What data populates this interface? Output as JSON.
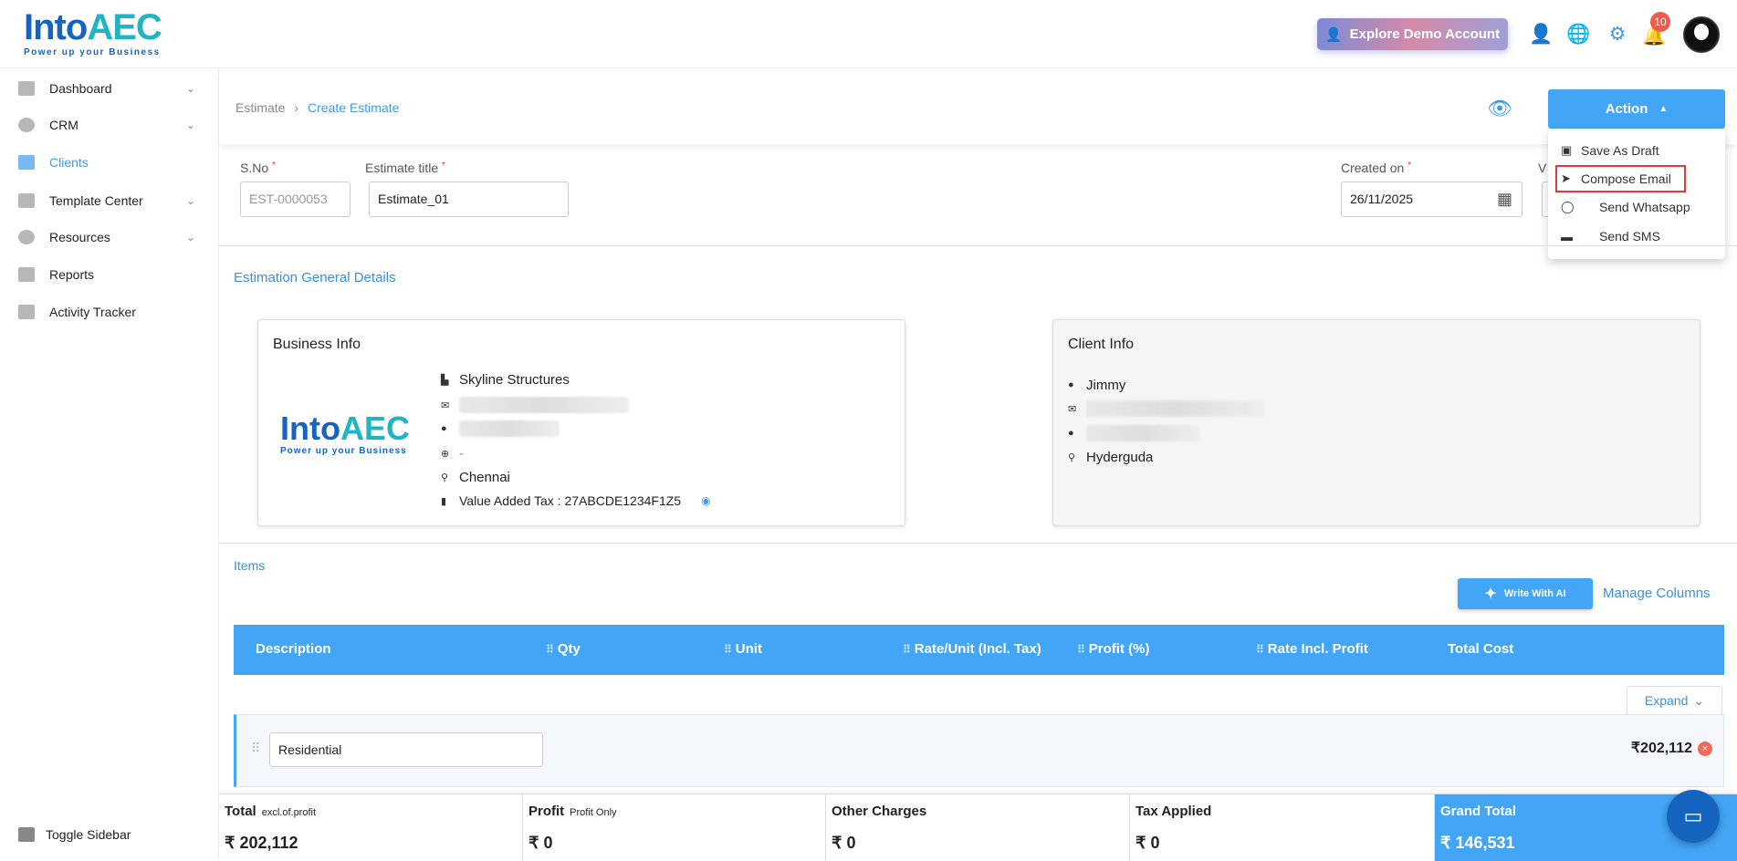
{
  "header": {
    "logo_text": "IntoAEC",
    "logo_tagline": "Power up your Business",
    "demo_button": "Explore Demo Account",
    "notification_count": "10"
  },
  "sidebar": {
    "items": [
      {
        "label": "Dashboard",
        "has_chevron": true
      },
      {
        "label": "CRM",
        "has_chevron": true
      },
      {
        "label": "Clients",
        "active": true
      },
      {
        "label": "Template Center",
        "has_chevron": true
      },
      {
        "label": "Resources",
        "has_chevron": true
      },
      {
        "label": "Reports"
      },
      {
        "label": "Activity Tracker"
      }
    ],
    "toggle_label": "Toggle Sidebar"
  },
  "breadcrumb": {
    "parent": "Estimate",
    "current": "Create Estimate"
  },
  "action": {
    "label": "Action",
    "menu": [
      "Save As Draft",
      "Compose Email",
      "Send Whatsapp",
      "Send SMS"
    ]
  },
  "form": {
    "sno_label": "S.No",
    "sno_value": "EST-0000053",
    "title_label": "Estimate title",
    "title_value": "Estimate_01",
    "created_label": "Created on",
    "created_value": "26/11/2025",
    "valid_label_partial": "V",
    "required_mark": "*"
  },
  "general": {
    "section_title": "Estimation General Details",
    "business": {
      "title": "Business Info",
      "name": "Skyline Structures",
      "website": "-",
      "city": "Chennai",
      "tax_label": "Value Added Tax :",
      "tax_value": "27ABCDE1234F1Z5"
    },
    "client": {
      "title": "Client Info",
      "name": "Jimmy",
      "location": "Hyderguda"
    }
  },
  "items": {
    "section_title": "Items",
    "write_ai": "Write With AI",
    "manage_columns": "Manage Columns",
    "columns": [
      "Description",
      "Qty",
      "Unit",
      "Rate/Unit (Incl. Tax)",
      "Profit (%)",
      "Rate Incl. Profit",
      "Total Cost"
    ],
    "expand": "Expand",
    "group": {
      "name": "Residential",
      "total": "₹202,112"
    }
  },
  "footer": {
    "total_label": "Total",
    "total_sub": "excl.of.profit",
    "total_value": "₹ 202,112",
    "profit_label": "Profit",
    "profit_sub": "Profit Only",
    "profit_value": "₹ 0",
    "other_label": "Other Charges",
    "other_value": "₹ 0",
    "tax_label": "Tax Applied",
    "tax_value": "₹ 0",
    "grand_label": "Grand Total",
    "grand_value": "₹ 146,531"
  },
  "colors": {
    "primary": "#42a5f5",
    "link": "#3d8fd8",
    "danger": "#e53935"
  }
}
